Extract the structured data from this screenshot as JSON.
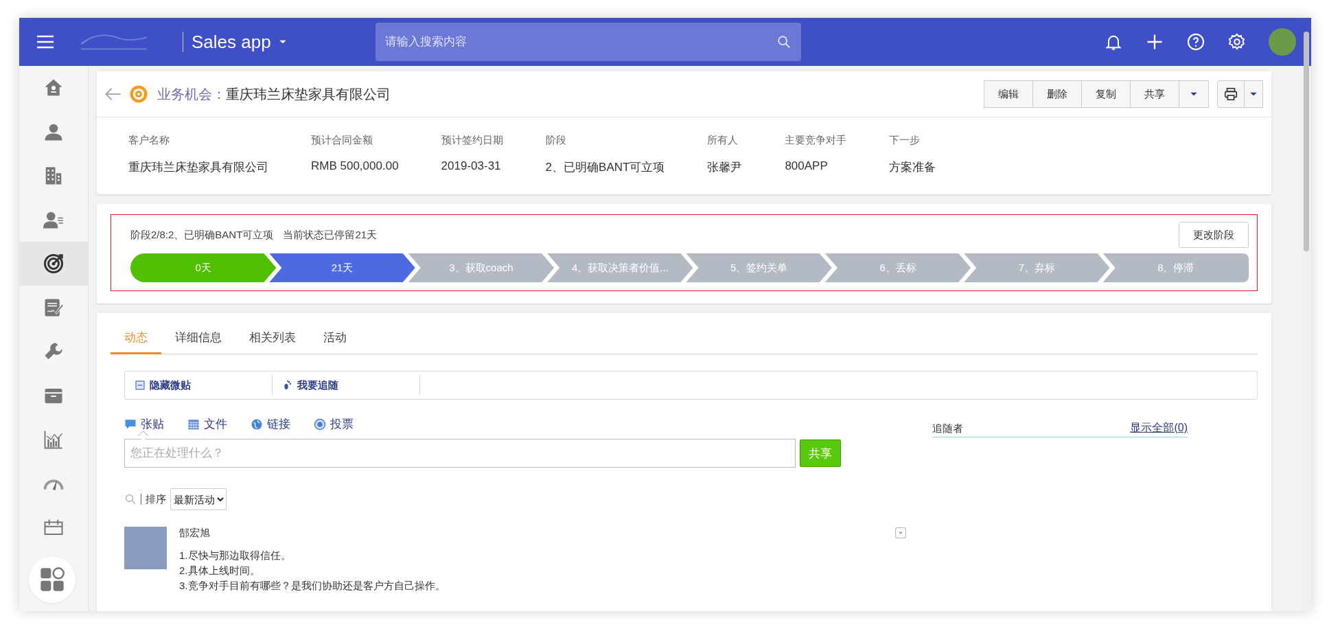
{
  "top_bar": {
    "app_name": "Sales app",
    "search": {
      "placeholder": "请输入搜索内容"
    }
  },
  "sidebar": {
    "items": [
      {
        "kind": "home",
        "selected": false
      },
      {
        "kind": "person",
        "selected": false
      },
      {
        "kind": "building",
        "selected": false
      },
      {
        "kind": "contact",
        "selected": false
      },
      {
        "kind": "target",
        "selected": true
      },
      {
        "kind": "contract",
        "selected": false
      },
      {
        "kind": "wrench",
        "selected": false
      },
      {
        "kind": "folder",
        "selected": false
      },
      {
        "kind": "chart",
        "selected": false
      },
      {
        "kind": "gauge",
        "selected": false
      },
      {
        "kind": "calendar",
        "selected": false
      }
    ]
  },
  "record": {
    "type_label": "业务机会：",
    "title": "重庆玮兰床垫家具有限公司",
    "actions": [
      "编辑",
      "删除",
      "复制",
      "共享"
    ],
    "fields": [
      {
        "label": "客户名称",
        "value": "重庆玮兰床垫家具有限公司"
      },
      {
        "label": "预计合同金额",
        "value": "RMB 500,000.00"
      },
      {
        "label": "预计签约日期",
        "value": "2019-03-31"
      },
      {
        "label": "阶段",
        "value": "2、已明确BANT可立项"
      },
      {
        "label": "所有人",
        "value": "张馨尹"
      },
      {
        "label": "主要竞争对手",
        "value": "800APP"
      },
      {
        "label": "下一步",
        "value": "方案准备"
      }
    ]
  },
  "stage": {
    "summary": "阶段2/8:2、已明确BANT可立项",
    "duration": "当前状态已停留21天",
    "change_button": "更改阶段",
    "stages": [
      {
        "label": "0天",
        "kind": "done"
      },
      {
        "label": "21天",
        "kind": "current"
      },
      {
        "label": "3、获取coach",
        "kind": "pending"
      },
      {
        "label": "4、获取决策者价值...",
        "kind": "pending"
      },
      {
        "label": "5、签约关单",
        "kind": "pending"
      },
      {
        "label": "6、丢标",
        "kind": "pending"
      },
      {
        "label": "7、弃标",
        "kind": "pending"
      },
      {
        "label": "8、停滞",
        "kind": "pending"
      }
    ]
  },
  "feed": {
    "tabs": [
      {
        "label": "动态",
        "selected": true
      },
      {
        "label": "详细信息",
        "selected": false
      },
      {
        "label": "相关列表",
        "selected": false
      },
      {
        "label": "活动",
        "selected": false
      }
    ],
    "toolbar": [
      {
        "kind": "hide",
        "label": "隐藏微贴"
      },
      {
        "kind": "follow",
        "label": "我要追随"
      }
    ],
    "composer": {
      "types": [
        {
          "kind": "post",
          "label": "张贴",
          "selected": true
        },
        {
          "kind": "file",
          "label": "文件",
          "selected": false
        },
        {
          "kind": "link",
          "label": "链接",
          "selected": false
        },
        {
          "kind": "poll",
          "label": "投票",
          "selected": false
        }
      ],
      "placeholder": "您正在处理什么？",
      "share_button": "共享"
    },
    "followers": {
      "title": "追随者",
      "show_all": "显示全部(0)"
    },
    "sort": {
      "label": "排序",
      "value": "最新活动"
    },
    "posts": [
      {
        "author": "郜宏旭",
        "lines": [
          "1.尽快与那边取得信任。",
          "2.具体上线时间。",
          "3.竞争对手目前有哪些？是我们协助还是客户方自己操作。"
        ]
      }
    ]
  }
}
